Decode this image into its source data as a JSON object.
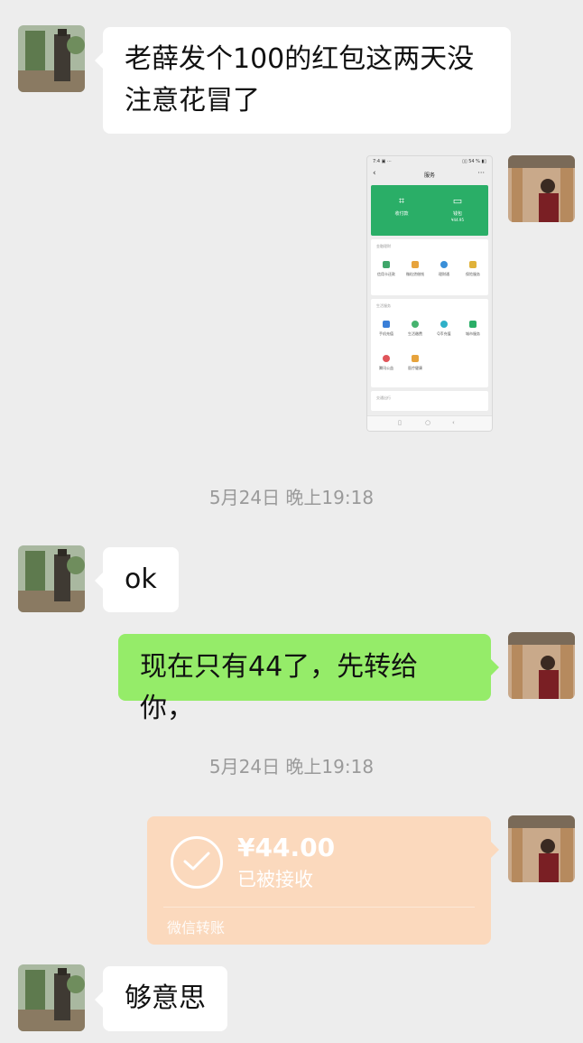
{
  "messages": [
    {
      "text": "老薛发个100的红包这两天没"
    },
    {
      "text": "注意花冒了"
    }
  ],
  "msg_ok": "ok",
  "msg_44": "现在只有44了，先转给你，",
  "msg_last": "够意思",
  "timestamps": [
    "5月24日 晚上19:18",
    "5月24日 晚上19:18"
  ],
  "transfer": {
    "amount": "¥44.00",
    "status": "已被接收",
    "brand": "微信转账"
  },
  "screenshot": {
    "status_left": "7:4 ▣ ···",
    "status_right": "▯▯ 54 % ▮▯",
    "nav_back": "‹",
    "nav_title": "服务",
    "nav_more": "···",
    "green_items": [
      {
        "icon": "⌗",
        "label": "收付款"
      },
      {
        "icon": "▭",
        "label": "钱包"
      }
    ],
    "green_sub": "¥44.95",
    "card1_title": "金融理财",
    "card1_items": [
      "信用卡还款",
      "微粒贷借钱",
      "理财通",
      "保险服务"
    ],
    "card2_title": "生活服务",
    "card2_items": [
      "手机充值",
      "生活缴费",
      "Q币充值",
      "城市服务",
      "腾讯公益",
      "医疗健康"
    ],
    "card3_title": "交通出行",
    "bottom": [
      "▯",
      "○",
      "‹"
    ]
  },
  "colors": {
    "sent_bubble": "#95ec69",
    "received_bubble": "#ffffff",
    "transfer_card": "#fbd9bd",
    "wechat_green": "#2aae67"
  }
}
